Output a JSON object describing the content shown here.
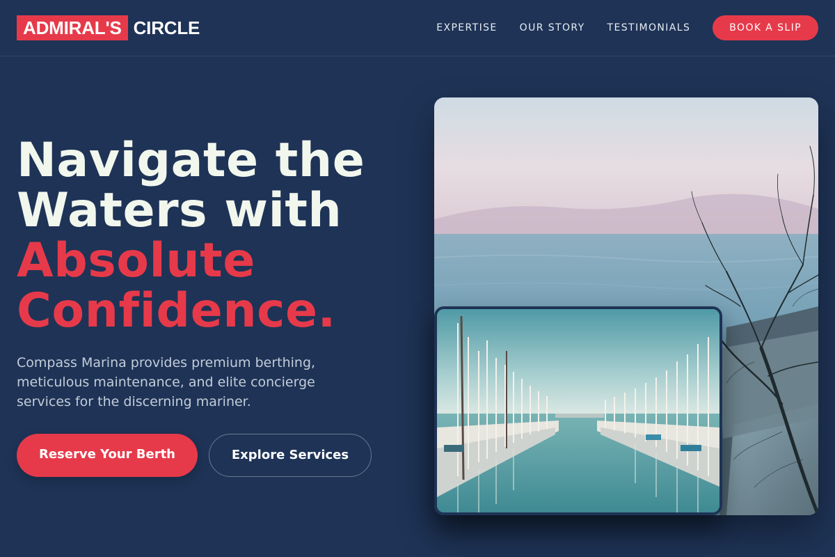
{
  "header": {
    "logo_box": "ADMIRAL'S",
    "logo_rest": "CIRCLE",
    "nav": [
      {
        "label": "EXPERTISE"
      },
      {
        "label": "OUR STORY"
      },
      {
        "label": "TESTIMONIALS"
      }
    ],
    "cta": "BOOK A SLIP"
  },
  "hero": {
    "title_line1": "Navigate the",
    "title_line2": "Waters with",
    "title_accent1": "Absolute",
    "title_accent2": "Confidence.",
    "description": "Compass Marina provides premium berthing, meticulous maintenance, and elite concierge services for the discerning mariner.",
    "primary_button": "Reserve Your Berth",
    "secondary_button": "Explore Services"
  },
  "colors": {
    "background": "#1e3356",
    "accent": "#e63a4a",
    "heading": "#f2f7ee",
    "body_text": "#c3cdd9"
  },
  "images": {
    "main_photo": "coastal-sea-with-bare-tree-photo",
    "inset_photo": "marina-harbor-sailboats-photo"
  }
}
